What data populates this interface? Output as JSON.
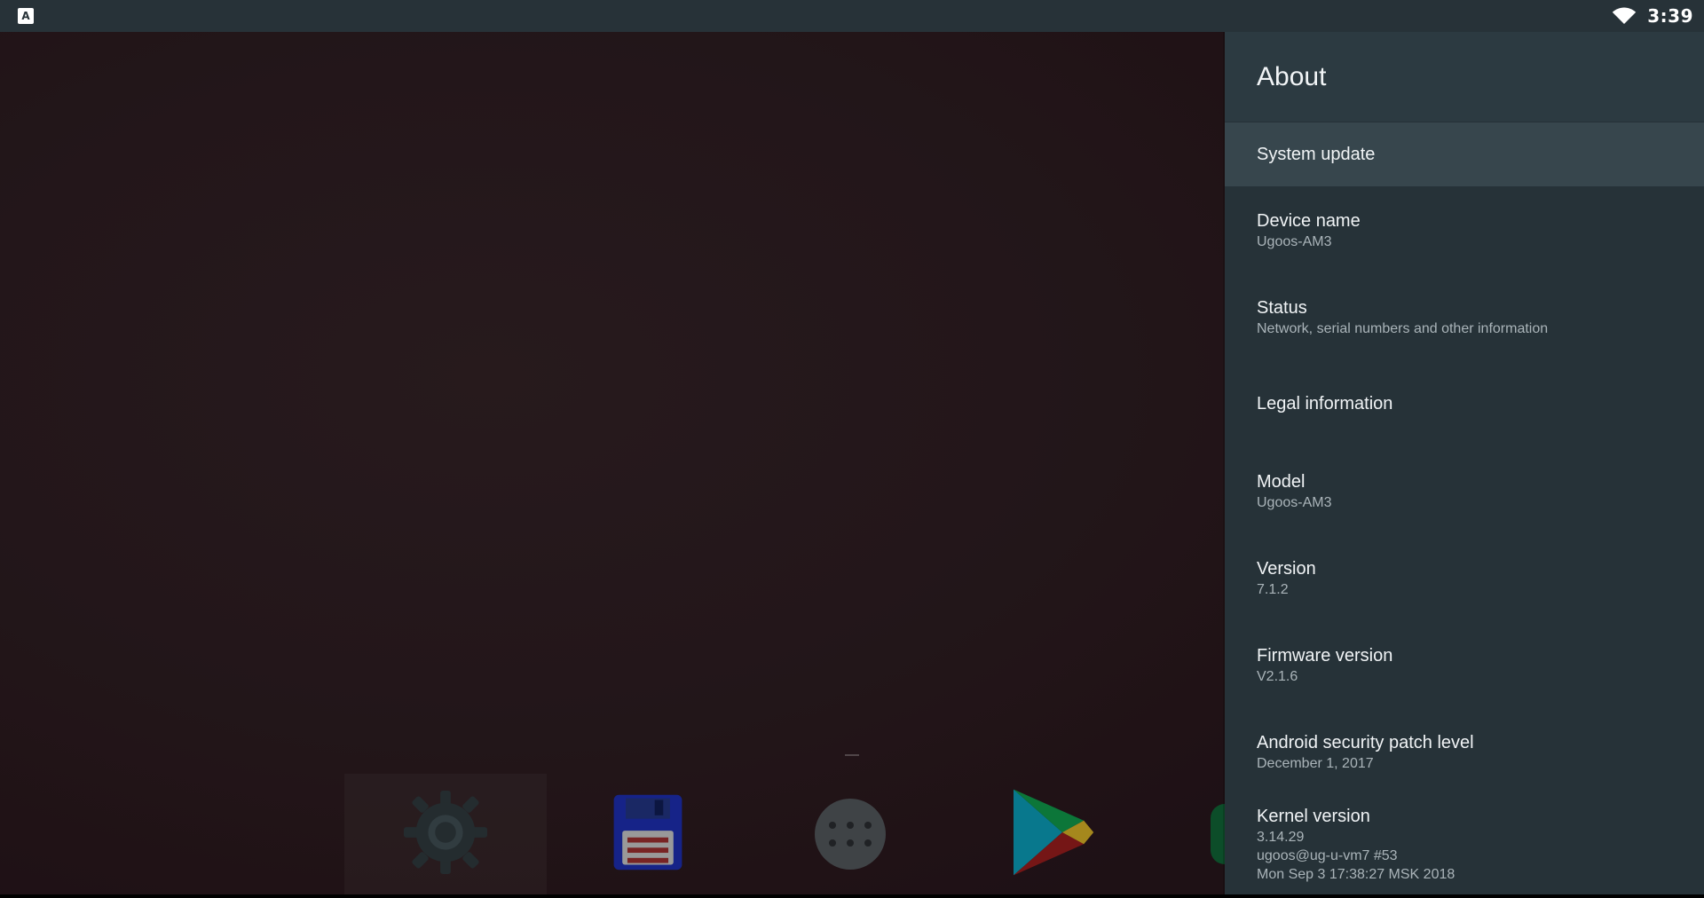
{
  "status_bar": {
    "time": "3:39",
    "left_icon": "A"
  },
  "panel": {
    "title": "About",
    "items": [
      {
        "title": "System update",
        "subtitle": ""
      },
      {
        "title": "Device name",
        "subtitle": "Ugoos-AM3"
      },
      {
        "title": "Status",
        "subtitle": "Network, serial numbers and other information"
      },
      {
        "title": "Legal information",
        "subtitle": ""
      },
      {
        "title": "Model",
        "subtitle": "Ugoos-AM3"
      },
      {
        "title": "Version",
        "subtitle": "7.1.2"
      },
      {
        "title": "Firmware version",
        "subtitle": "V2.1.6"
      },
      {
        "title": "Android security patch level",
        "subtitle": "December 1, 2017"
      },
      {
        "title": "Kernel version",
        "subtitle_lines": [
          "3.14.29",
          "ugoos@ug-u-vm7 #53",
          "Mon Sep 3 17:38:27 MSK 2018"
        ]
      }
    ]
  },
  "dock": {
    "apps": [
      {
        "icon": "settings-gear-icon"
      },
      {
        "icon": "floppy-disk-icon"
      },
      {
        "icon": "all-apps-icon"
      },
      {
        "icon": "play-store-icon"
      },
      {
        "icon": "partial-app-icon"
      }
    ]
  },
  "colors": {
    "panel_bg": "#263238",
    "header_bg": "#2c3a41",
    "selected_bg": "#37464d",
    "status_bg": "#273238"
  }
}
